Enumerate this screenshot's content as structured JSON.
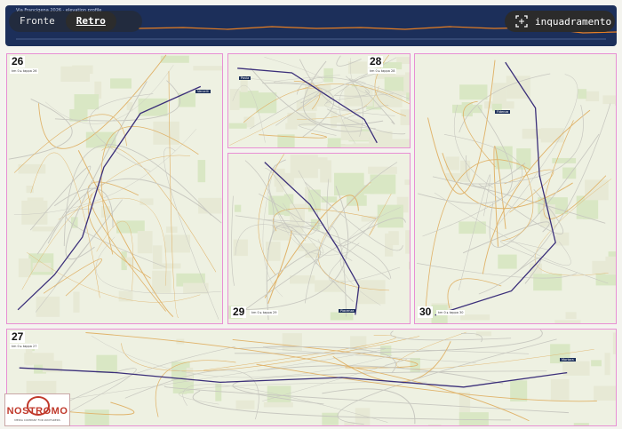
{
  "profile": {
    "title": "Via Francigena 2026 · elevation profile"
  },
  "view_toggle": {
    "front_label": "Fronte",
    "back_label": "Retro",
    "selected": "Retro"
  },
  "frame_button": {
    "label": "inquadramento",
    "icon": "crop-frame-icon"
  },
  "sheets": [
    {
      "number": "26",
      "legend": "km 0 ▸ tappa 26",
      "place": "Vercelli"
    },
    {
      "number": "28",
      "legend": "km 0 ▸ tappa 28",
      "place": "Pavia"
    },
    {
      "number": "29",
      "legend": "km 0 ▸ tappa 29",
      "place": "Piacenza"
    },
    {
      "number": "30",
      "legend": "km 0 ▸ tappa 30",
      "place": "Fidenza"
    },
    {
      "number": "27",
      "legend": "km 0 ▸ tappa 27",
      "place": "Mortara"
    }
  ],
  "logo": {
    "wordmark": "NOSTROMO",
    "tagline": "MEDIA COMPANY FOR WAYFARERS"
  },
  "colors": {
    "route": "#3b2f7a",
    "sheet_border": "#e88fd4",
    "profile_bg": "#1c2f5a",
    "accent": "#c0392b"
  }
}
